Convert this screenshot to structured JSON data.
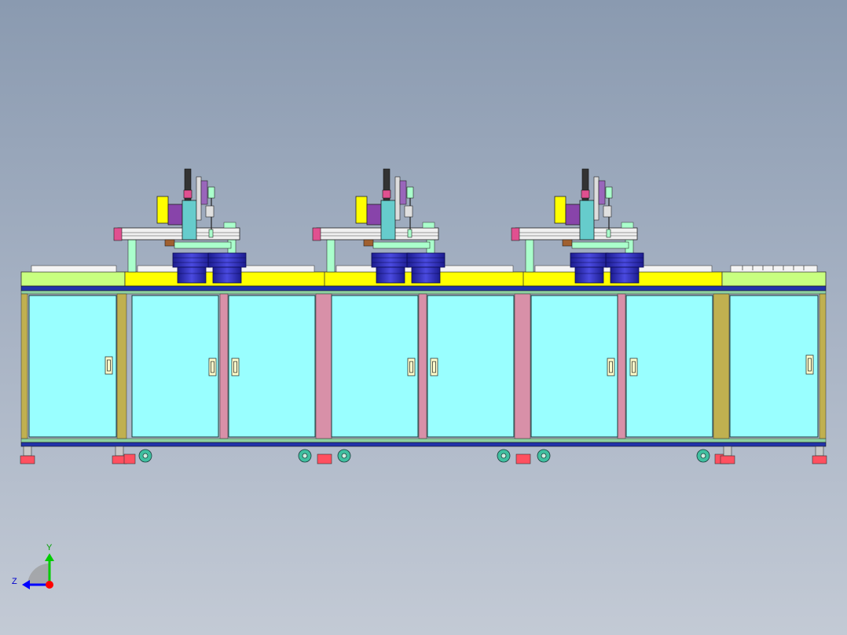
{
  "viewport": {
    "colors": {
      "bg_top": "#8a9ab0",
      "bg_bottom": "#c3cad5",
      "cabinet_panel": "#99ffff",
      "frame_green": "#c8ff80",
      "table_yellow": "#ffff00",
      "bowl_blue": "#3333cc",
      "bowl_dark": "#1a1a80",
      "rail_blue": "#2233aa",
      "caster_green": "#40c0a0",
      "foot_red": "#ff5060",
      "arm_teal": "#66cccc",
      "arm_purple": "#8844aa",
      "arm_magenta": "#e05090",
      "guide_mint": "#aaffcc"
    }
  },
  "triad": {
    "y_label": "Y",
    "z_label": "Z",
    "y_color": "#00cc00",
    "z_color": "#0000ff",
    "origin_color": "#ff0000"
  }
}
